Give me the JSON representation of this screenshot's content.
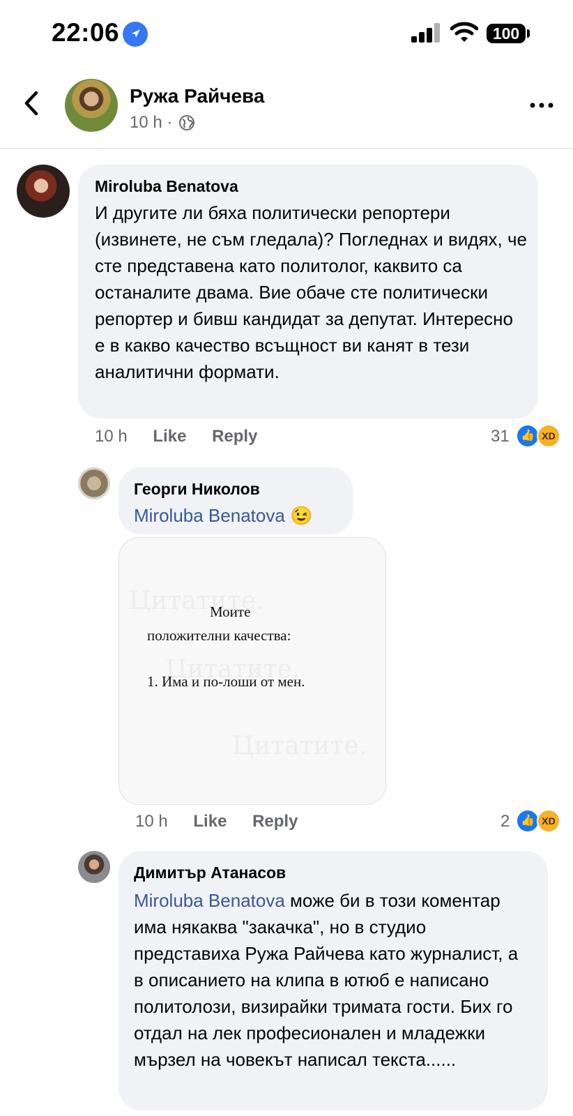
{
  "status_bar": {
    "time": "22:06",
    "battery": "100"
  },
  "post_header": {
    "name": "Ружа Райчева",
    "age": "10 h",
    "separator": "·"
  },
  "comments": [
    {
      "author": "Miroluba Benatova",
      "text": "И другите ли бяха политически репортери (извинете, не съм гледала)? Погледнах и видях, че сте представена като политолог, каквито са останалите двама. Вие обаче сте политически репортер и бивш кандидат за депутат. Интересно е в какво качество всъщност ви канят в тези аналитични формати.",
      "time": "10 h",
      "like": "Like",
      "reply": "Reply",
      "reactions": "31"
    },
    {
      "author": "Георги Николов",
      "mention": "Miroluba Benatova",
      "emoji": "😉",
      "image": {
        "line1": "Моите",
        "line2": "положителни качества:",
        "line3": "1. Има и по-лоши от мен.",
        "watermark": "Цитатите."
      },
      "time": "10 h",
      "like": "Like",
      "reply": "Reply",
      "reactions": "2"
    },
    {
      "author": "Димитър Атанасов",
      "mention": "Miroluba Benatova",
      "text_first": "може би в този",
      "text_rest": "коментар има някаква \"закачка\", но в студио представиха Ружа Райчева като журналист, а в описанието на клипа в ютюб е написано политолози, визирайки тримата гости. Бих го отдал на лек професионален и младежки мързел на човекът написал текста......"
    }
  ],
  "icons": [
    "location-arrow-icon",
    "signal-icon",
    "wifi-icon",
    "battery-icon",
    "back-chevron-icon",
    "globe-icon",
    "more-icon",
    "like-reaction-icon",
    "haha-reaction-icon"
  ],
  "colors": {
    "bubble": "#f0f2f5",
    "mention": "#385898",
    "meta": "#65676b",
    "like": "#1877f2",
    "haha": "#f7b125"
  }
}
